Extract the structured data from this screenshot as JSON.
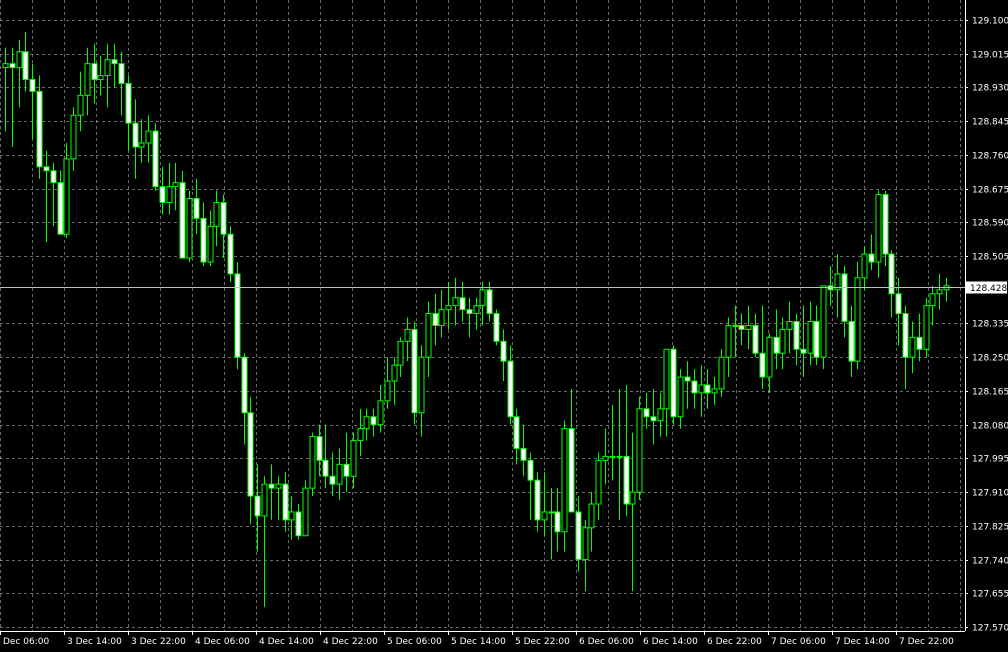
{
  "chart_data": {
    "type": "candlestick",
    "instrument_timeframe": "",
    "colors": {
      "background": "#000000",
      "grid": "#c0c0c0",
      "candle_bull_body": "#000000",
      "candle_bear_body": "#ffffff",
      "candle_outline": "#00ff00",
      "wick": "#00ff00",
      "axis": "#ffffff",
      "current_price_line": "#c0c0c0",
      "current_price_tag_bg": "#ffffff",
      "current_price_tag_text": "#000000"
    },
    "grid": true,
    "ylim": [
      127.57,
      129.1
    ],
    "y_ticks": [
      "129.100",
      "129.015",
      "128.930",
      "128.845",
      "128.760",
      "128.675",
      "128.590",
      "128.505",
      "128.335",
      "128.250",
      "128.165",
      "128.080",
      "127.995",
      "127.910",
      "127.825",
      "127.740",
      "127.655",
      "127.570"
    ],
    "current_price": 128.428,
    "current_price_label": "128.428",
    "x_ticks": [
      "Dec 06:00",
      "3 Dec 14:00",
      "3 Dec 22:00",
      "4 Dec 06:00",
      "4 Dec 14:00",
      "4 Dec 22:00",
      "5 Dec 06:00",
      "5 Dec 14:00",
      "5 Dec 22:00",
      "6 Dec 06:00",
      "6 Dec 14:00",
      "6 Dec 22:00",
      "7 Dec 06:00",
      "7 Dec 14:00",
      "7 Dec 22:00"
    ],
    "candles_ohlc": [
      [
        128.98,
        129.03,
        128.82,
        128.99
      ],
      [
        128.99,
        129.03,
        128.78,
        128.98
      ],
      [
        128.98,
        129.05,
        128.88,
        129.02
      ],
      [
        129.02,
        129.07,
        128.92,
        128.95
      ],
      [
        128.95,
        128.99,
        128.8,
        128.92
      ],
      [
        128.92,
        128.96,
        128.7,
        128.73
      ],
      [
        128.73,
        128.77,
        128.54,
        128.72
      ],
      [
        128.72,
        128.74,
        128.58,
        128.69
      ],
      [
        128.69,
        128.72,
        128.57,
        128.56
      ],
      [
        128.56,
        128.79,
        128.55,
        128.75
      ],
      [
        128.75,
        128.88,
        128.72,
        128.86
      ],
      [
        128.86,
        128.97,
        128.82,
        128.91
      ],
      [
        128.91,
        129.03,
        128.86,
        128.99
      ],
      [
        128.99,
        129.04,
        128.89,
        128.95
      ],
      [
        128.95,
        129.01,
        128.91,
        128.96
      ],
      [
        128.96,
        129.04,
        128.88,
        129.0
      ],
      [
        129.0,
        129.04,
        128.93,
        128.99
      ],
      [
        128.99,
        129.02,
        128.86,
        128.94
      ],
      [
        128.94,
        128.96,
        128.77,
        128.84
      ],
      [
        128.84,
        128.9,
        128.7,
        128.78
      ],
      [
        128.78,
        128.85,
        128.74,
        128.79
      ],
      [
        128.79,
        128.86,
        128.74,
        128.82
      ],
      [
        128.82,
        128.84,
        128.67,
        128.68
      ],
      [
        128.68,
        128.73,
        128.61,
        128.64
      ],
      [
        128.64,
        128.74,
        128.61,
        128.68
      ],
      [
        128.68,
        128.74,
        128.62,
        128.69
      ],
      [
        128.69,
        128.72,
        128.5,
        128.5
      ],
      [
        128.5,
        128.67,
        128.49,
        128.65
      ],
      [
        128.65,
        128.7,
        128.56,
        128.6
      ],
      [
        128.6,
        128.64,
        128.48,
        128.49
      ],
      [
        128.49,
        128.62,
        128.48,
        128.58
      ],
      [
        128.58,
        128.67,
        128.53,
        128.64
      ],
      [
        128.64,
        128.66,
        128.5,
        128.56
      ],
      [
        128.56,
        128.58,
        128.44,
        128.46
      ],
      [
        128.46,
        128.49,
        128.22,
        128.25
      ],
      [
        128.25,
        128.26,
        128.03,
        128.11
      ],
      [
        128.11,
        128.15,
        127.83,
        127.9
      ],
      [
        127.9,
        127.98,
        127.76,
        127.85
      ],
      [
        127.85,
        127.95,
        127.62,
        127.93
      ],
      [
        127.93,
        127.98,
        127.84,
        127.92
      ],
      [
        127.92,
        127.95,
        127.84,
        127.93
      ],
      [
        127.93,
        127.96,
        127.81,
        127.84
      ],
      [
        127.84,
        127.9,
        127.79,
        127.86
      ],
      [
        127.86,
        127.88,
        127.79,
        127.8
      ],
      [
        127.8,
        127.94,
        127.8,
        127.92
      ],
      [
        127.92,
        128.06,
        127.9,
        128.05
      ],
      [
        128.05,
        128.08,
        127.95,
        127.99
      ],
      [
        127.99,
        128.08,
        127.92,
        127.95
      ],
      [
        127.95,
        128.01,
        127.9,
        127.93
      ],
      [
        127.93,
        128.02,
        127.89,
        127.98
      ],
      [
        127.98,
        128.06,
        127.91,
        127.95
      ],
      [
        127.95,
        128.06,
        127.92,
        128.04
      ],
      [
        128.04,
        128.12,
        128.0,
        128.07
      ],
      [
        128.07,
        128.12,
        128.04,
        128.1
      ],
      [
        128.1,
        128.12,
        128.05,
        128.08
      ],
      [
        128.08,
        128.18,
        128.06,
        128.14
      ],
      [
        128.14,
        128.25,
        128.12,
        128.19
      ],
      [
        128.19,
        128.25,
        128.13,
        128.23
      ],
      [
        128.23,
        128.3,
        128.2,
        128.29
      ],
      [
        128.29,
        128.35,
        128.24,
        128.32
      ],
      [
        128.32,
        128.34,
        128.08,
        128.11
      ],
      [
        128.11,
        128.28,
        128.05,
        128.25
      ],
      [
        128.25,
        128.39,
        128.2,
        128.36
      ],
      [
        128.36,
        128.41,
        128.28,
        128.33
      ],
      [
        128.33,
        128.42,
        128.3,
        128.37
      ],
      [
        128.37,
        128.44,
        128.32,
        128.38
      ],
      [
        128.38,
        128.45,
        128.33,
        128.4
      ],
      [
        128.4,
        128.44,
        128.34,
        128.37
      ],
      [
        128.37,
        128.4,
        128.3,
        128.36
      ],
      [
        128.36,
        128.4,
        128.32,
        128.38
      ],
      [
        128.38,
        128.44,
        128.33,
        128.42
      ],
      [
        128.42,
        128.44,
        128.34,
        128.36
      ],
      [
        128.36,
        128.37,
        128.28,
        128.29
      ],
      [
        128.29,
        128.32,
        128.19,
        128.24
      ],
      [
        128.24,
        128.28,
        128.08,
        128.1
      ],
      [
        128.1,
        128.12,
        127.98,
        128.02
      ],
      [
        128.02,
        128.08,
        127.95,
        127.99
      ],
      [
        127.99,
        128.01,
        127.84,
        127.94
      ],
      [
        127.94,
        127.96,
        127.81,
        127.84
      ],
      [
        127.84,
        127.96,
        127.8,
        127.86
      ],
      [
        127.86,
        127.92,
        127.74,
        127.86
      ],
      [
        127.86,
        127.92,
        127.76,
        127.81
      ],
      [
        127.81,
        128.09,
        127.76,
        128.07
      ],
      [
        128.07,
        128.17,
        127.93,
        127.86
      ],
      [
        127.86,
        127.9,
        127.71,
        127.74
      ],
      [
        127.74,
        127.84,
        127.66,
        127.82
      ],
      [
        127.82,
        127.91,
        127.76,
        127.88
      ],
      [
        127.88,
        128.01,
        127.84,
        127.99
      ],
      [
        127.99,
        128.07,
        127.93,
        128.0
      ],
      [
        128.0,
        128.13,
        127.94,
        128.0
      ],
      [
        128.0,
        128.17,
        127.84,
        128.0
      ],
      [
        128.0,
        128.18,
        127.85,
        127.88
      ],
      [
        127.88,
        128.06,
        127.66,
        127.91
      ],
      [
        127.91,
        128.15,
        127.89,
        128.12
      ],
      [
        128.12,
        128.16,
        128.07,
        128.1
      ],
      [
        128.1,
        128.17,
        128.03,
        128.09
      ],
      [
        128.09,
        128.16,
        128.05,
        128.12
      ],
      [
        128.12,
        128.23,
        128.05,
        128.27
      ],
      [
        128.27,
        128.28,
        128.08,
        128.1
      ],
      [
        128.1,
        128.22,
        128.07,
        128.2
      ],
      [
        128.2,
        128.24,
        128.12,
        128.19
      ],
      [
        128.19,
        128.22,
        128.12,
        128.16
      ],
      [
        128.16,
        128.23,
        128.1,
        128.18
      ],
      [
        128.18,
        128.22,
        128.12,
        128.16
      ],
      [
        128.16,
        128.2,
        128.13,
        128.17
      ],
      [
        128.17,
        128.27,
        128.15,
        128.25
      ],
      [
        128.25,
        128.35,
        128.2,
        128.33
      ],
      [
        128.33,
        128.38,
        128.25,
        128.33
      ],
      [
        128.33,
        128.36,
        128.28,
        128.32
      ],
      [
        128.32,
        128.38,
        128.27,
        128.33
      ],
      [
        128.33,
        128.36,
        128.25,
        128.26
      ],
      [
        128.26,
        128.38,
        128.17,
        128.2
      ],
      [
        128.2,
        128.31,
        128.16,
        128.3
      ],
      [
        128.3,
        128.37,
        128.22,
        128.26
      ],
      [
        128.26,
        128.35,
        128.22,
        128.32
      ],
      [
        128.32,
        128.39,
        128.26,
        128.34
      ],
      [
        128.34,
        128.36,
        128.23,
        128.27
      ],
      [
        128.27,
        128.38,
        128.2,
        128.26
      ],
      [
        128.26,
        128.39,
        128.23,
        128.34
      ],
      [
        128.34,
        128.38,
        128.23,
        128.25
      ],
      [
        128.25,
        128.42,
        128.22,
        128.43
      ],
      [
        128.43,
        128.48,
        128.38,
        128.42
      ],
      [
        128.42,
        128.51,
        128.35,
        128.46
      ],
      [
        128.46,
        128.48,
        128.3,
        128.34
      ],
      [
        128.34,
        128.38,
        128.2,
        128.24
      ],
      [
        128.24,
        128.49,
        128.22,
        128.45
      ],
      [
        128.45,
        128.53,
        128.42,
        128.51
      ],
      [
        128.51,
        128.56,
        128.47,
        128.49
      ],
      [
        128.49,
        128.67,
        128.45,
        128.66
      ],
      [
        128.66,
        128.67,
        128.48,
        128.51
      ],
      [
        128.51,
        128.52,
        128.35,
        128.41
      ],
      [
        128.41,
        128.45,
        128.28,
        128.36
      ],
      [
        128.36,
        128.38,
        128.17,
        128.25
      ],
      [
        128.25,
        128.34,
        128.21,
        128.3
      ],
      [
        128.3,
        128.36,
        128.24,
        128.27
      ],
      [
        128.27,
        128.4,
        128.25,
        128.38
      ],
      [
        128.38,
        128.43,
        128.33,
        128.41
      ],
      [
        128.41,
        128.46,
        128.37,
        128.42
      ],
      [
        128.42,
        128.45,
        128.39,
        128.43
      ]
    ]
  }
}
